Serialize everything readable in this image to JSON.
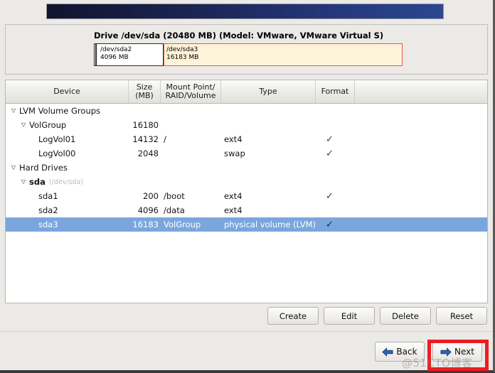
{
  "window": {
    "banner_label": "installer-banner"
  },
  "drive": {
    "title": "Drive /dev/sda (20480 MB) (Model: VMware, VMware Virtual S)",
    "segments": [
      {
        "name": "",
        "size": "",
        "kind": "boot-sliver"
      },
      {
        "name": "/dev/sda2",
        "size": "4096 MB",
        "kind": "normal"
      },
      {
        "name": "/dev/sda3",
        "size": "16183 MB",
        "kind": "highlighted"
      }
    ]
  },
  "table": {
    "columns": [
      {
        "id": "device",
        "label": "Device"
      },
      {
        "id": "size",
        "label": "Size\n(MB)",
        "line1": "Size",
        "line2": "(MB)"
      },
      {
        "id": "mount",
        "label": "Mount Point/\nRAID/Volume",
        "line1": "Mount Point/",
        "line2": "RAID/Volume"
      },
      {
        "id": "type",
        "label": "Type"
      },
      {
        "id": "format",
        "label": "Format"
      },
      {
        "id": "spacer",
        "label": ""
      }
    ],
    "rows": [
      {
        "level": 0,
        "twisty": "▽",
        "device": "LVM Volume Groups",
        "path": "",
        "bold": false,
        "size": "",
        "mount": "",
        "type": "",
        "format": false,
        "selected": false
      },
      {
        "level": 1,
        "twisty": "▽",
        "device": "VolGroup",
        "path": "",
        "bold": false,
        "size": "16180",
        "mount": "",
        "type": "",
        "format": false,
        "selected": false
      },
      {
        "level": 2,
        "twisty": "",
        "device": "LogVol01",
        "path": "",
        "bold": false,
        "size": "14132",
        "mount": "/",
        "type": "ext4",
        "format": true,
        "selected": false
      },
      {
        "level": 2,
        "twisty": "",
        "device": "LogVol00",
        "path": "",
        "bold": false,
        "size": "2048",
        "mount": "",
        "type": "swap",
        "format": true,
        "selected": false
      },
      {
        "level": 0,
        "twisty": "▽",
        "device": "Hard Drives",
        "path": "",
        "bold": false,
        "size": "",
        "mount": "",
        "type": "",
        "format": false,
        "selected": false
      },
      {
        "level": 1,
        "twisty": "▽",
        "device": "sda",
        "path": "(/dev/sda)",
        "bold": true,
        "size": "",
        "mount": "",
        "type": "",
        "format": false,
        "selected": false
      },
      {
        "level": 2,
        "twisty": "",
        "device": "sda1",
        "path": "",
        "bold": false,
        "size": "200",
        "mount": "/boot",
        "type": "ext4",
        "format": true,
        "selected": false
      },
      {
        "level": 2,
        "twisty": "",
        "device": "sda2",
        "path": "",
        "bold": false,
        "size": "4096",
        "mount": "/data",
        "type": "ext4",
        "format": false,
        "selected": false
      },
      {
        "level": 2,
        "twisty": "",
        "device": "sda3",
        "path": "",
        "bold": false,
        "size": "16183",
        "mount": "VolGroup",
        "type": "physical volume (LVM)",
        "format": true,
        "selected": true
      }
    ],
    "check_glyph": "✓"
  },
  "actions": {
    "create": "Create",
    "edit": "Edit",
    "delete": "Delete",
    "reset": "Reset"
  },
  "nav": {
    "back": "Back",
    "next": "Next"
  },
  "annotation": {
    "highlight_color": "#ee1c22"
  },
  "watermark": {
    "text": "@51CTO博客"
  },
  "colors": {
    "selection": "#7ba6dd",
    "partition_highlight_border": "#e8574a",
    "partition_highlight_fill": "#fdf3d9",
    "banner_dark": "#11142e",
    "banner_light": "#2a4790",
    "check": "#2c3560"
  }
}
